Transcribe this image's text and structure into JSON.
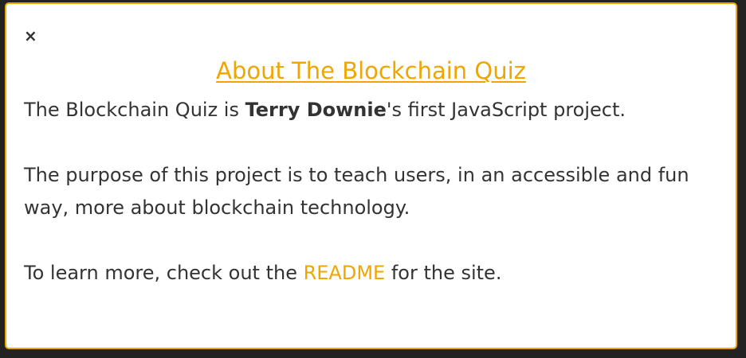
{
  "modal": {
    "close_symbol": "×",
    "title": "About The Blockchain Quiz",
    "intro_prefix": "The Blockchain Quiz is ",
    "author": "Terry Downie",
    "intro_suffix": "'s first JavaScript project.",
    "purpose": "The purpose of this project is to teach users, in an accessible and fun way, more about blockchain technology.",
    "learn_prefix": "To learn more, check out the ",
    "readme_label": "README",
    "learn_suffix": " for the site."
  },
  "colors": {
    "accent": "#f0a500",
    "text": "#333333",
    "background": "#ffffff"
  }
}
